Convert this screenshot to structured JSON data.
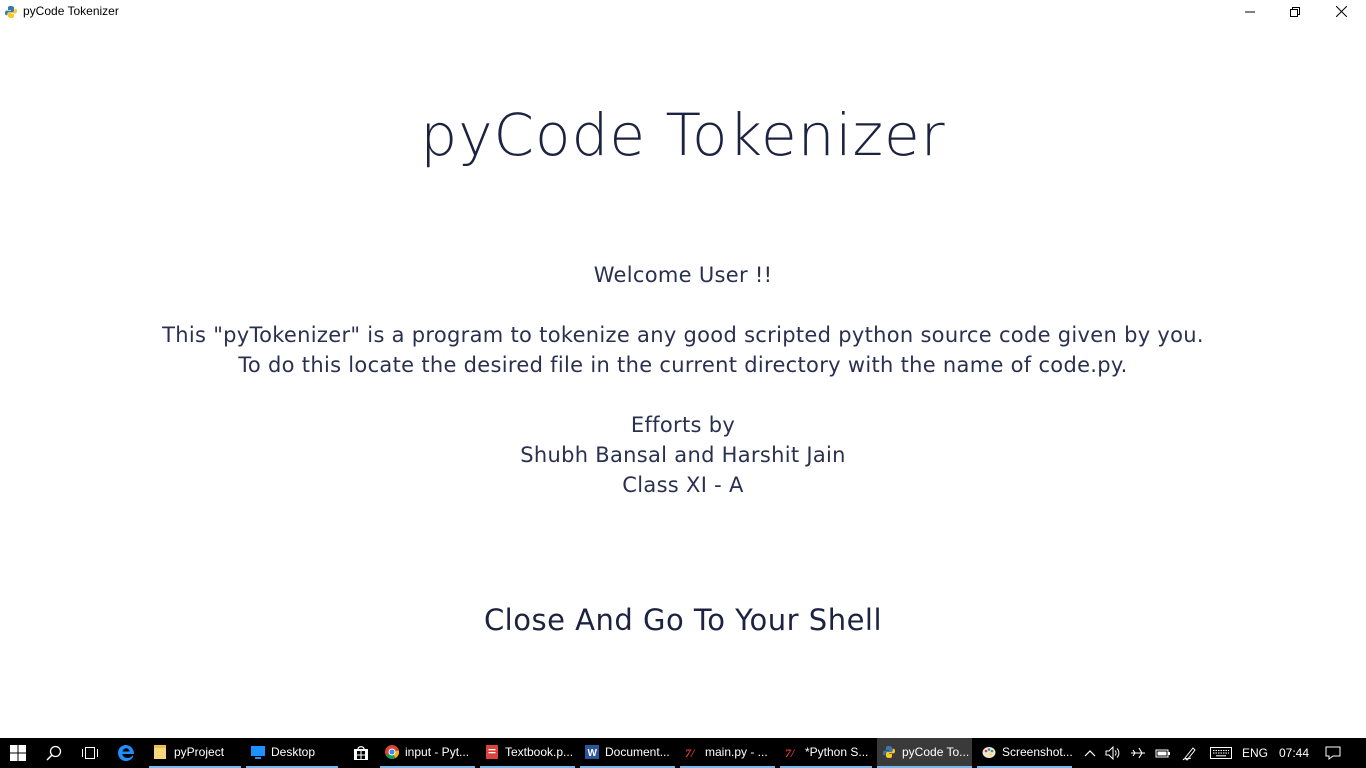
{
  "window": {
    "title": "pyCode Tokenizer"
  },
  "content": {
    "app_title": "pyCode Tokenizer",
    "welcome": "Welcome User !!",
    "description_line1": "This \"pyTokenizer\" is a program to tokenize any good scripted python source code given by you.",
    "description_line2": "To do this locate the desired file in the current directory with the name of code.py.",
    "efforts_label": "Efforts by",
    "authors": "Shubh Bansal and Harshit Jain",
    "class_label": "Class XI - A",
    "close_button_label": "Close And Go To Your Shell"
  },
  "taskbar": {
    "items": [
      {
        "label": "pyProject",
        "icon": "folder-icon"
      },
      {
        "label": "Desktop",
        "icon": "desktop-icon"
      },
      {
        "label": "input - Pyt...",
        "icon": "chrome-icon"
      },
      {
        "label": "Textbook.p...",
        "icon": "pdf-icon"
      },
      {
        "label": "Document...",
        "icon": "word-icon"
      },
      {
        "label": "main.py - ...",
        "icon": "python-idle-icon"
      },
      {
        "label": "*Python S...",
        "icon": "python-idle-icon"
      },
      {
        "label": "pyCode To...",
        "icon": "python-icon"
      },
      {
        "label": "Screenshot...",
        "icon": "paint-icon"
      }
    ],
    "language": "ENG",
    "time": "07:44"
  },
  "colors": {
    "text_primary": "#1c2340",
    "taskbar_bg": "#000000",
    "running_indicator": "#76b9ed"
  }
}
